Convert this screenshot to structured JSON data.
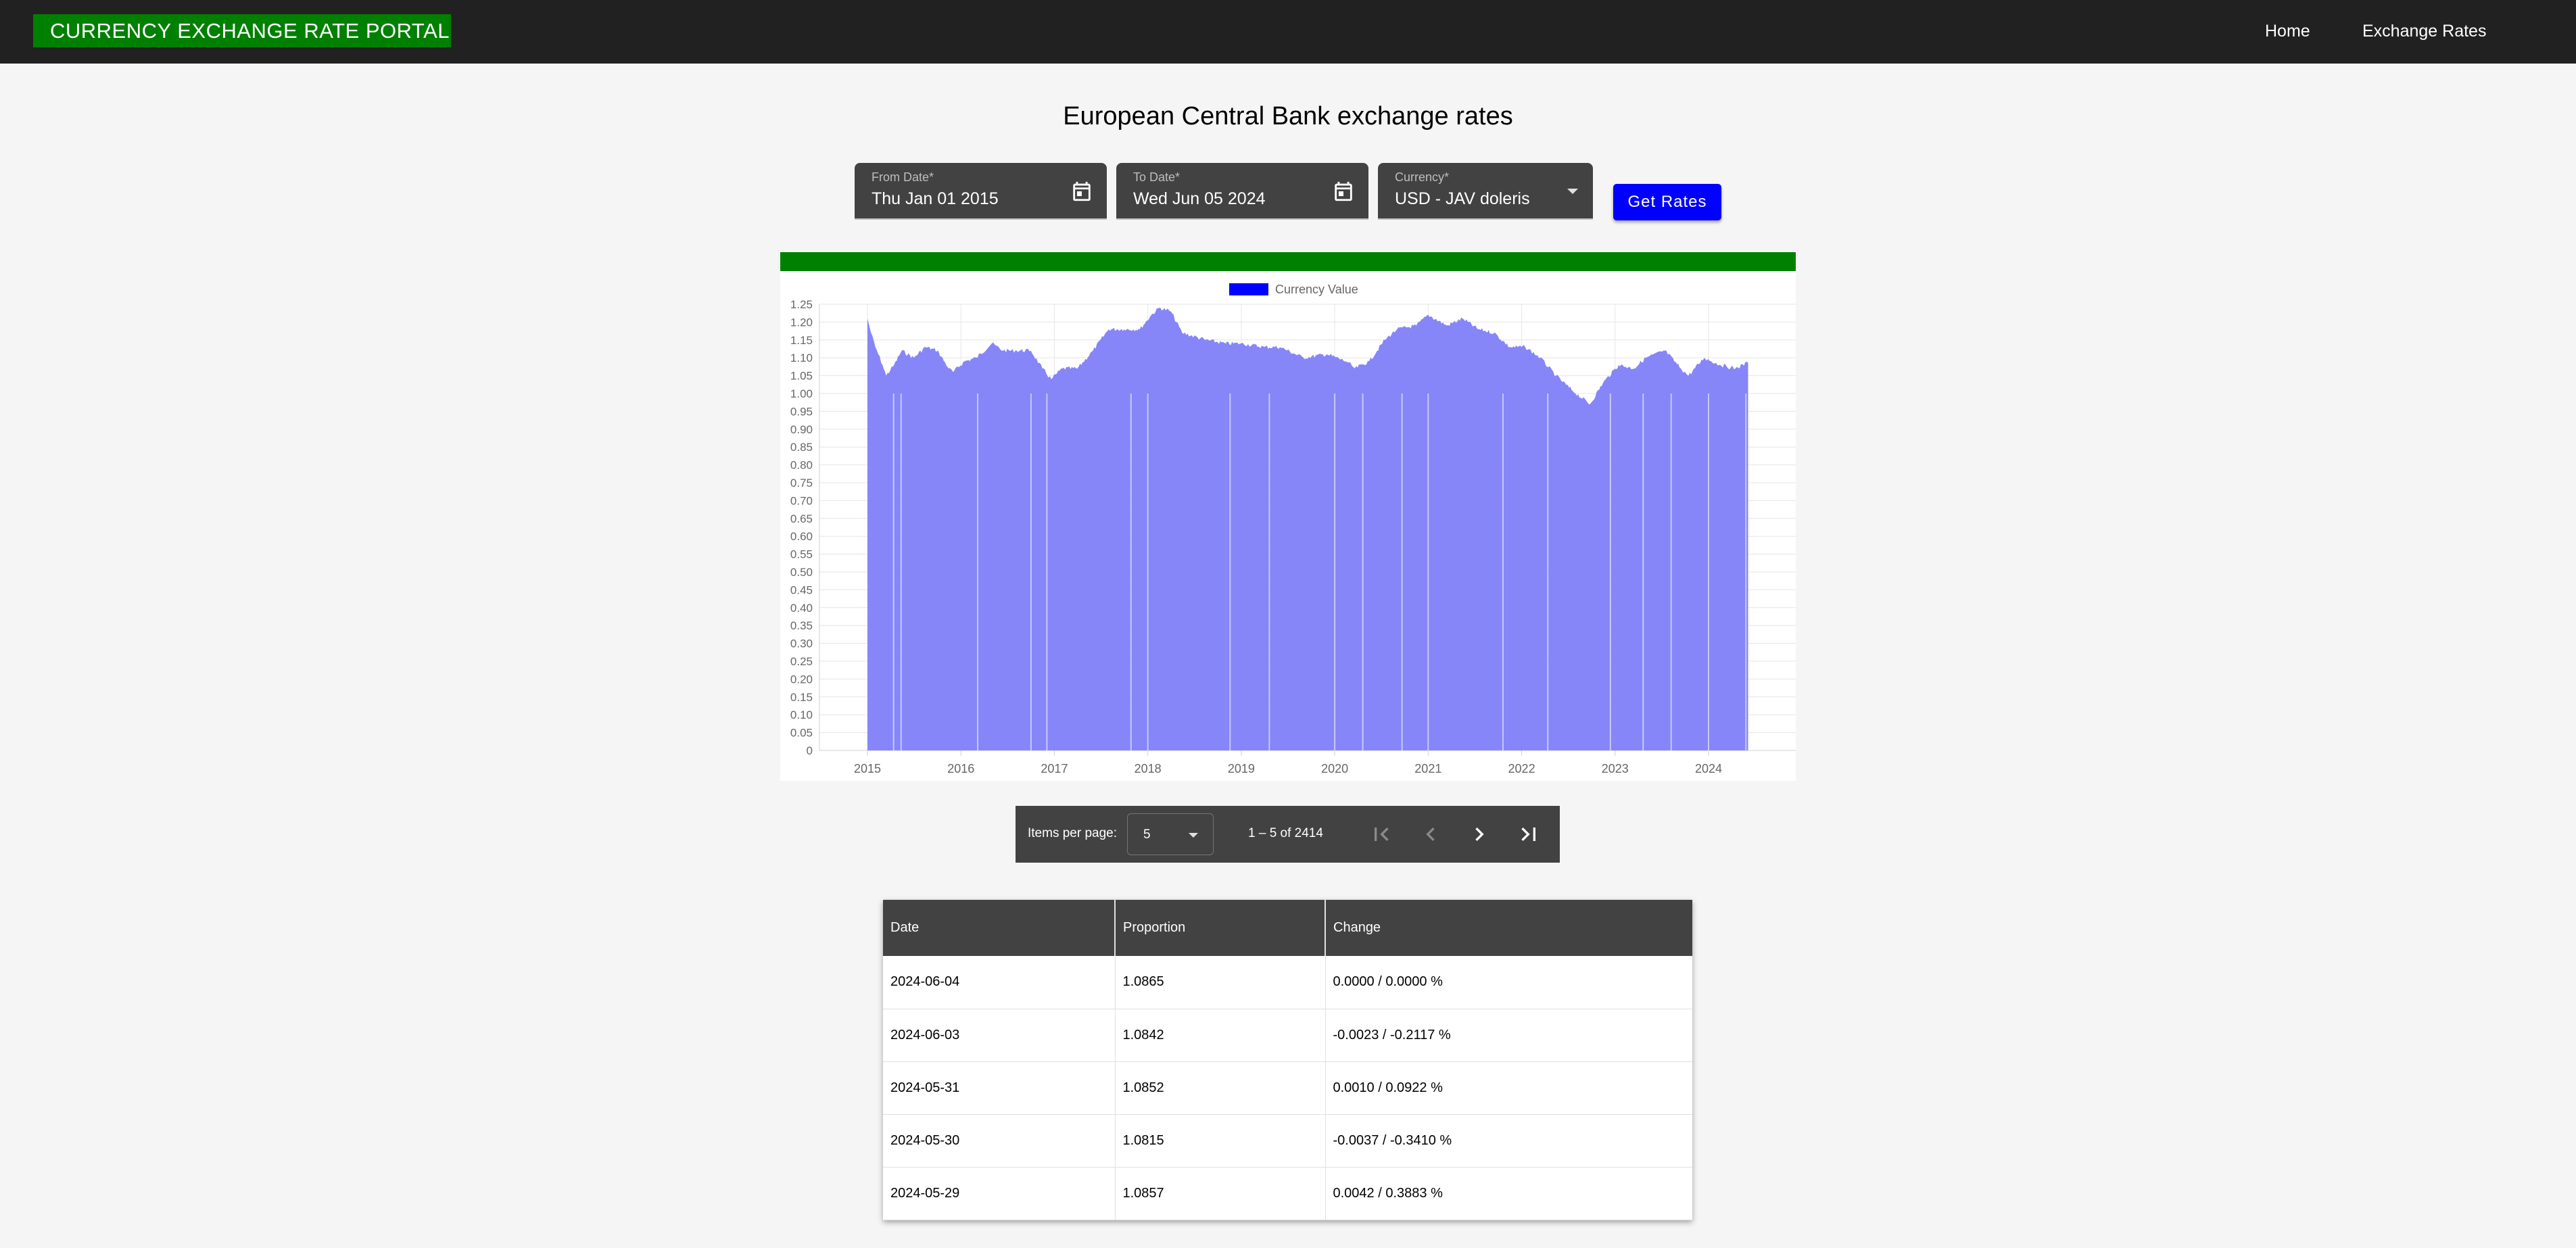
{
  "app": {
    "brand": "CURRENCY EXCHANGE RATE PORTAL",
    "nav": {
      "home": "Home",
      "exchange_rates": "Exchange Rates"
    }
  },
  "page": {
    "title": "European Central Bank exchange rates"
  },
  "form": {
    "from_date": {
      "label": "From Date*",
      "value": "Thu Jan 01 2015",
      "icon": "calendar-icon"
    },
    "to_date": {
      "label": "To Date*",
      "value": "Wed Jun 05 2024",
      "icon": "calendar-icon"
    },
    "currency": {
      "label": "Currency*",
      "value": "USD - JAV doleris",
      "icon": "dropdown-arrow-icon"
    },
    "get_rates_label": "Get Rates"
  },
  "colors": {
    "brand": "#008000",
    "toolbar": "#212121",
    "panel": "#424242",
    "button": "#0000ff",
    "series_fill": "#8080f8",
    "series_legend": "#0000ff"
  },
  "chart_data": {
    "type": "area",
    "legend": "Currency Value",
    "legend_position": "top-center",
    "grid": true,
    "x_ticks": [
      "2015",
      "2016",
      "2017",
      "2018",
      "2019",
      "2020",
      "2021",
      "2022",
      "2023",
      "2024"
    ],
    "ylim": [
      0,
      1.25
    ],
    "y_ticks": [
      "0",
      "0.05",
      "0.10",
      "0.15",
      "0.20",
      "0.25",
      "0.30",
      "0.35",
      "0.40",
      "0.45",
      "0.50",
      "0.55",
      "0.60",
      "0.65",
      "0.70",
      "0.75",
      "0.80",
      "0.85",
      "0.90",
      "0.95",
      "1.00",
      "1.05",
      "1.10",
      "1.15",
      "1.20",
      "1.25"
    ],
    "series": [
      {
        "name": "Currency Value",
        "points": [
          [
            "2015-01-01",
            1.21
          ],
          [
            "2015-01-15",
            1.17
          ],
          [
            "2015-02-01",
            1.13
          ],
          [
            "2015-03-01",
            1.08
          ],
          [
            "2015-03-15",
            1.05
          ],
          [
            "2015-04-15",
            1.08
          ],
          [
            "2015-05-15",
            1.12
          ],
          [
            "2015-07-01",
            1.1
          ],
          [
            "2015-08-15",
            1.13
          ],
          [
            "2015-10-01",
            1.12
          ],
          [
            "2015-11-15",
            1.07
          ],
          [
            "2015-12-01",
            1.06
          ],
          [
            "2016-01-15",
            1.09
          ],
          [
            "2016-03-01",
            1.1
          ],
          [
            "2016-05-01",
            1.14
          ],
          [
            "2016-06-15",
            1.12
          ],
          [
            "2016-08-01",
            1.12
          ],
          [
            "2016-10-01",
            1.12
          ],
          [
            "2016-11-15",
            1.07
          ],
          [
            "2016-12-20",
            1.04
          ],
          [
            "2017-02-01",
            1.07
          ],
          [
            "2017-04-01",
            1.07
          ],
          [
            "2017-06-01",
            1.12
          ],
          [
            "2017-08-01",
            1.18
          ],
          [
            "2017-10-01",
            1.18
          ],
          [
            "2017-12-01",
            1.18
          ],
          [
            "2018-01-15",
            1.22
          ],
          [
            "2018-02-15",
            1.24
          ],
          [
            "2018-04-01",
            1.23
          ],
          [
            "2018-05-15",
            1.17
          ],
          [
            "2018-08-15",
            1.15
          ],
          [
            "2018-11-01",
            1.14
          ],
          [
            "2019-01-01",
            1.14
          ],
          [
            "2019-04-01",
            1.13
          ],
          [
            "2019-06-01",
            1.13
          ],
          [
            "2019-09-01",
            1.1
          ],
          [
            "2019-12-01",
            1.11
          ],
          [
            "2020-02-15",
            1.09
          ],
          [
            "2020-03-20",
            1.07
          ],
          [
            "2020-05-15",
            1.09
          ],
          [
            "2020-07-15",
            1.15
          ],
          [
            "2020-09-01",
            1.18
          ],
          [
            "2020-11-15",
            1.19
          ],
          [
            "2021-01-01",
            1.22
          ],
          [
            "2021-03-15",
            1.19
          ],
          [
            "2021-05-15",
            1.21
          ],
          [
            "2021-07-15",
            1.18
          ],
          [
            "2021-09-15",
            1.17
          ],
          [
            "2021-11-15",
            1.13
          ],
          [
            "2022-01-15",
            1.13
          ],
          [
            "2022-03-15",
            1.1
          ],
          [
            "2022-05-15",
            1.05
          ],
          [
            "2022-07-15",
            1.01
          ],
          [
            "2022-09-25",
            0.97
          ],
          [
            "2022-11-15",
            1.03
          ],
          [
            "2023-01-15",
            1.08
          ],
          [
            "2023-03-15",
            1.07
          ],
          [
            "2023-05-01",
            1.1
          ],
          [
            "2023-07-15",
            1.12
          ],
          [
            "2023-09-15",
            1.07
          ],
          [
            "2023-10-15",
            1.05
          ],
          [
            "2023-12-15",
            1.1
          ],
          [
            "2024-02-15",
            1.08
          ],
          [
            "2024-04-15",
            1.07
          ],
          [
            "2024-06-04",
            1.0865
          ]
        ]
      }
    ]
  },
  "paginator": {
    "items_per_page_label": "Items per page:",
    "items_per_page_value": "5",
    "range_label": "1 – 5 of 2414"
  },
  "table": {
    "headers": [
      "Date",
      "Proportion",
      "Change"
    ],
    "rows": [
      [
        "2024-06-04",
        "1.0865",
        "0.0000 / 0.0000 %"
      ],
      [
        "2024-06-03",
        "1.0842",
        "-0.0023 / -0.2117 %"
      ],
      [
        "2024-05-31",
        "1.0852",
        "0.0010 / 0.0922 %"
      ],
      [
        "2024-05-30",
        "1.0815",
        "-0.0037 / -0.3410 %"
      ],
      [
        "2024-05-29",
        "1.0857",
        "0.0042 / 0.3883 %"
      ]
    ]
  }
}
